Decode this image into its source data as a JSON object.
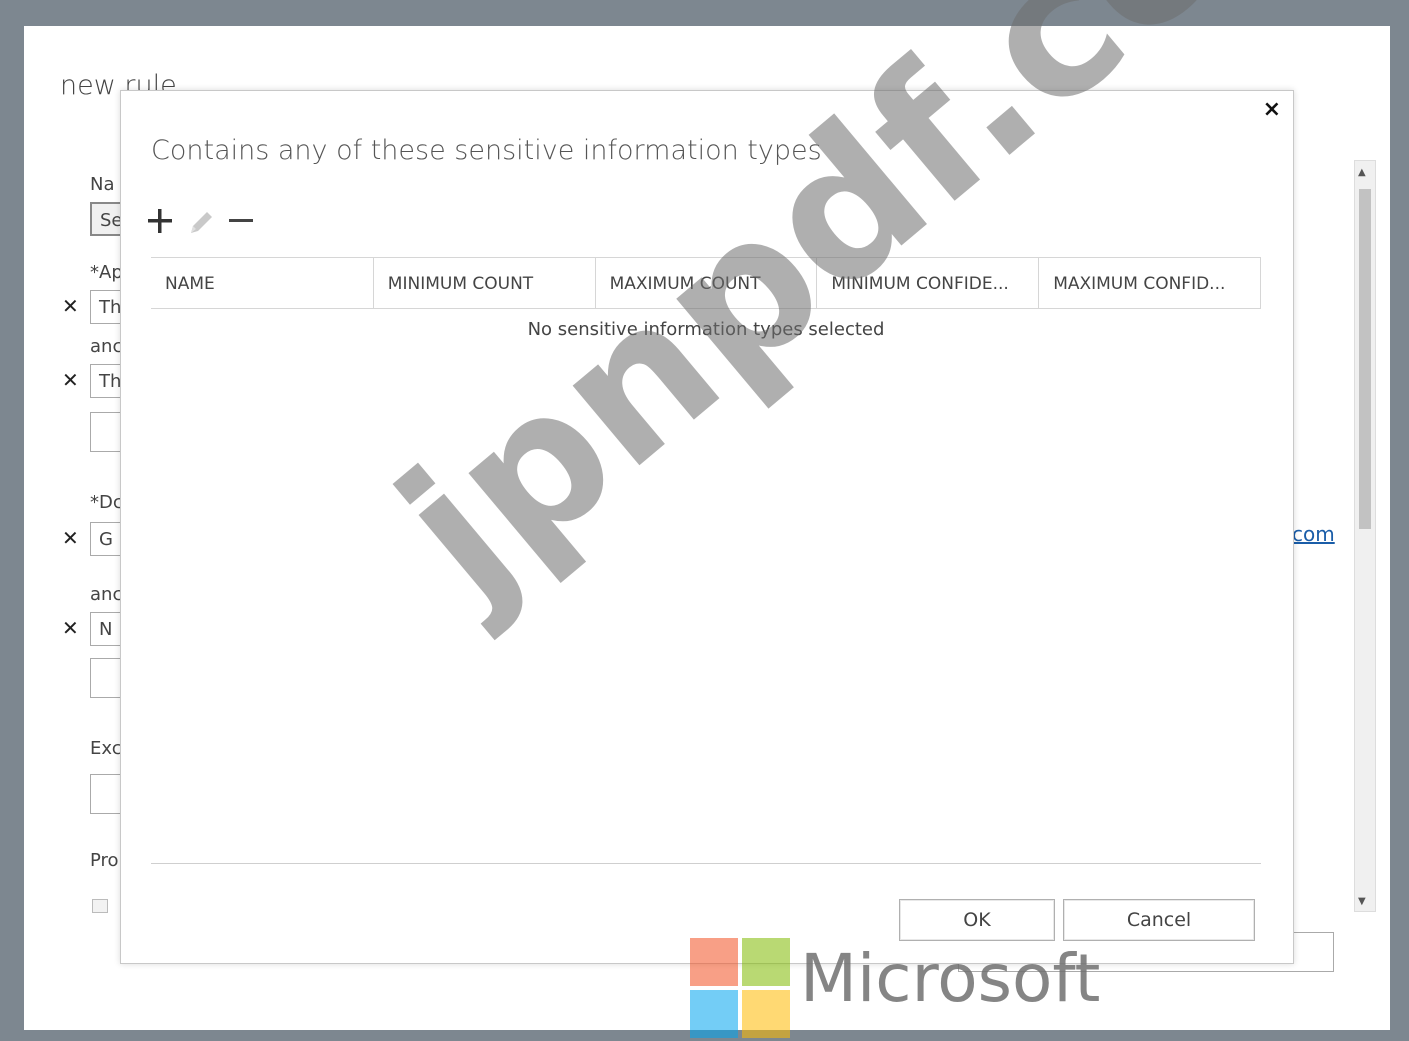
{
  "page": {
    "title": "new rule"
  },
  "background_form": {
    "name_label": "Na",
    "name_value": "Se",
    "apply_label": "*Ap",
    "condition1_value": "Th",
    "and1_label": "anc",
    "condition2_value": "Th",
    "do_label": "*Dc",
    "action1_value": "G",
    "and2_label": "anc",
    "action2_value": "N",
    "except_label": "Exc",
    "properties_label": "Pro",
    "link_fragment": "com"
  },
  "dialog": {
    "title": "Contains any of these sensitive information types",
    "close_label": "×",
    "toolbar": {
      "add_icon": "plus-icon",
      "edit_icon": "pencil-icon",
      "remove_icon": "minus-icon"
    },
    "columns": [
      "NAME",
      "MINIMUM COUNT",
      "MAXIMUM COUNT",
      "MINIMUM CONFIDE...",
      "MAXIMUM CONFID..."
    ],
    "empty_message": "No sensitive information types selected",
    "ok_label": "OK",
    "cancel_label": "Cancel"
  },
  "watermark": {
    "text": "jpnpdf.com"
  },
  "logo": {
    "text": "Microsoft",
    "colors": [
      "#f25022",
      "#7fba00",
      "#00a4ef",
      "#ffb900"
    ]
  },
  "colors": {
    "frame": "#7d8790",
    "link": "#1a5da8"
  }
}
